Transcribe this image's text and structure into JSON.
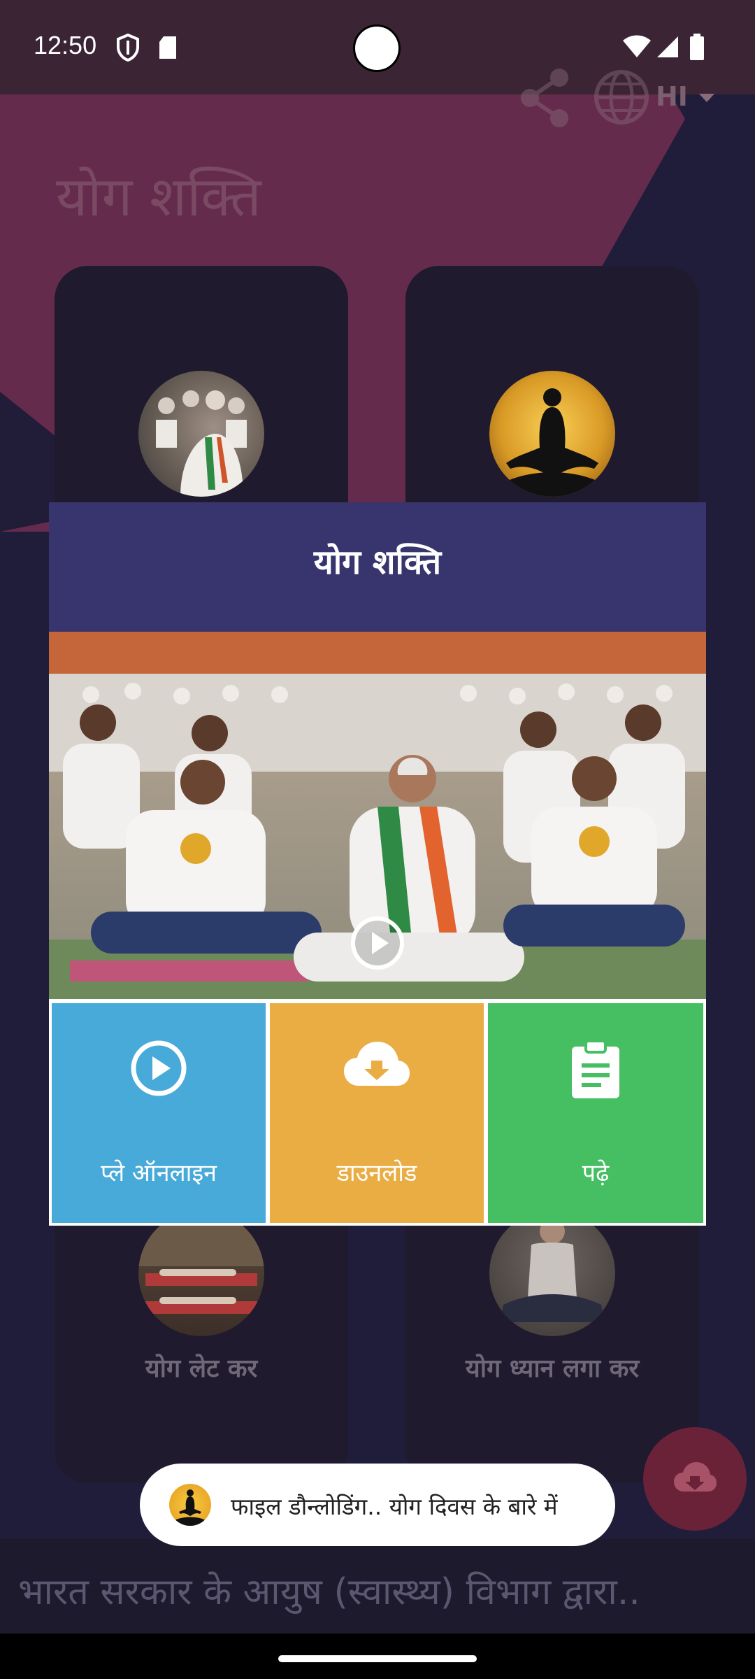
{
  "status_bar": {
    "time": "12:50"
  },
  "app": {
    "title": "योग शक्ति",
    "language": "HI"
  },
  "cards": [
    {
      "caption": "योग लेट कर"
    },
    {
      "caption": "योग ध्यान लगा कर"
    }
  ],
  "ticker": "भारत सरकार के आयुष (स्वास्थ्य) विभाग  द्वारा..",
  "dialog": {
    "title": "योग शक्ति",
    "actions": [
      {
        "label": "प्ले ऑनलाइन",
        "icon": "play-circle-icon"
      },
      {
        "label": "डाउनलोड",
        "icon": "cloud-download-icon"
      },
      {
        "label": "पढ़े",
        "icon": "clipboard-icon"
      }
    ]
  },
  "toast": {
    "text": "फाइल डौन्लोडिंग.. योग दिवस के बारे में"
  },
  "colors": {
    "header": "#38356e",
    "play_tile": "#47aad8",
    "download_tile": "#e9ad44",
    "read_tile": "#46be62"
  }
}
